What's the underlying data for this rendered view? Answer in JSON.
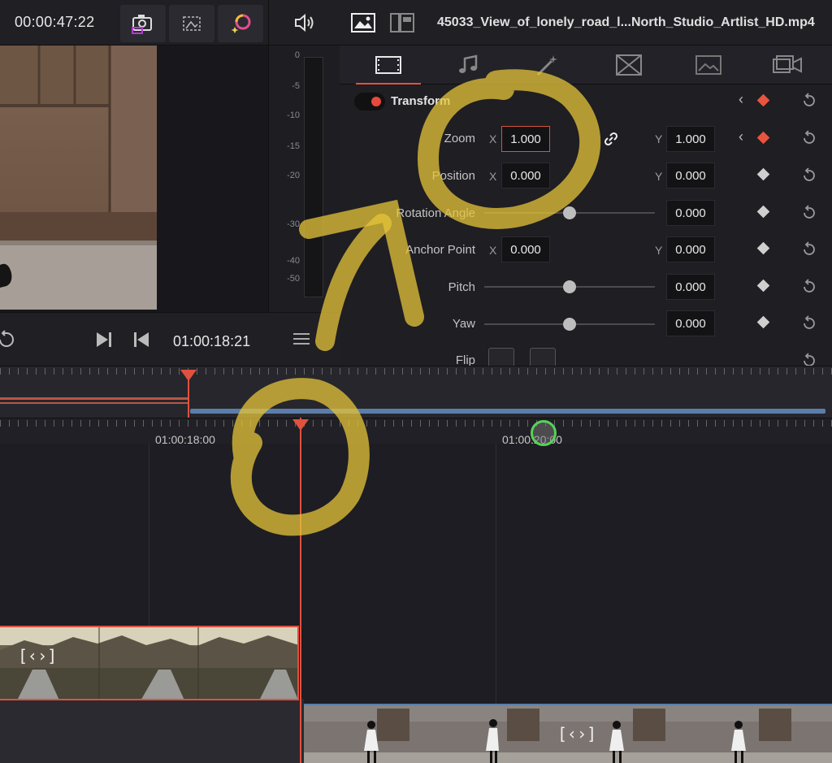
{
  "viewer": {
    "timecode": "00:00:47:22",
    "transport_timecode": "01:00:18:21"
  },
  "audio_meter": {
    "scale": [
      "0",
      "-5",
      "-10",
      "-15",
      "-20",
      "-30",
      "-40",
      "-50"
    ]
  },
  "inspector": {
    "clip_title": "45033_View_of_lonely_road_l...North_Studio_Artlist_HD.mp4",
    "tabs": [
      {
        "icon": "video-icon",
        "active": true
      },
      {
        "icon": "audio-icon",
        "active": false
      },
      {
        "icon": "effects-icon",
        "active": false
      },
      {
        "icon": "transition-icon",
        "active": false
      },
      {
        "icon": "image-icon",
        "active": false
      },
      {
        "icon": "file-icon",
        "active": false
      }
    ],
    "section_title": "Transform",
    "zoom": {
      "label": "Zoom",
      "x_axis": "X",
      "y_axis": "Y",
      "x": "1.000",
      "y": "1.000"
    },
    "position": {
      "label": "Position",
      "x_axis": "X",
      "y_axis": "Y",
      "x": "0.000",
      "y": "0.000"
    },
    "rotation": {
      "label": "Rotation Angle",
      "value": "0.000"
    },
    "anchor": {
      "label": "Anchor Point",
      "x_axis": "X",
      "y_axis": "Y",
      "x": "0.000",
      "y": "0.000"
    },
    "pitch": {
      "label": "Pitch",
      "value": "0.000"
    },
    "yaw": {
      "label": "Yaw",
      "value": "0.000"
    },
    "flip": {
      "label": "Flip"
    }
  },
  "timeline": {
    "ruler_labels": [
      "01:00:18:00",
      "01:00:20:00"
    ]
  },
  "colors": {
    "accent_red": "#e0513f",
    "annotation_yellow": "#e6c43a",
    "clip_blue": "#5a7ea9"
  }
}
